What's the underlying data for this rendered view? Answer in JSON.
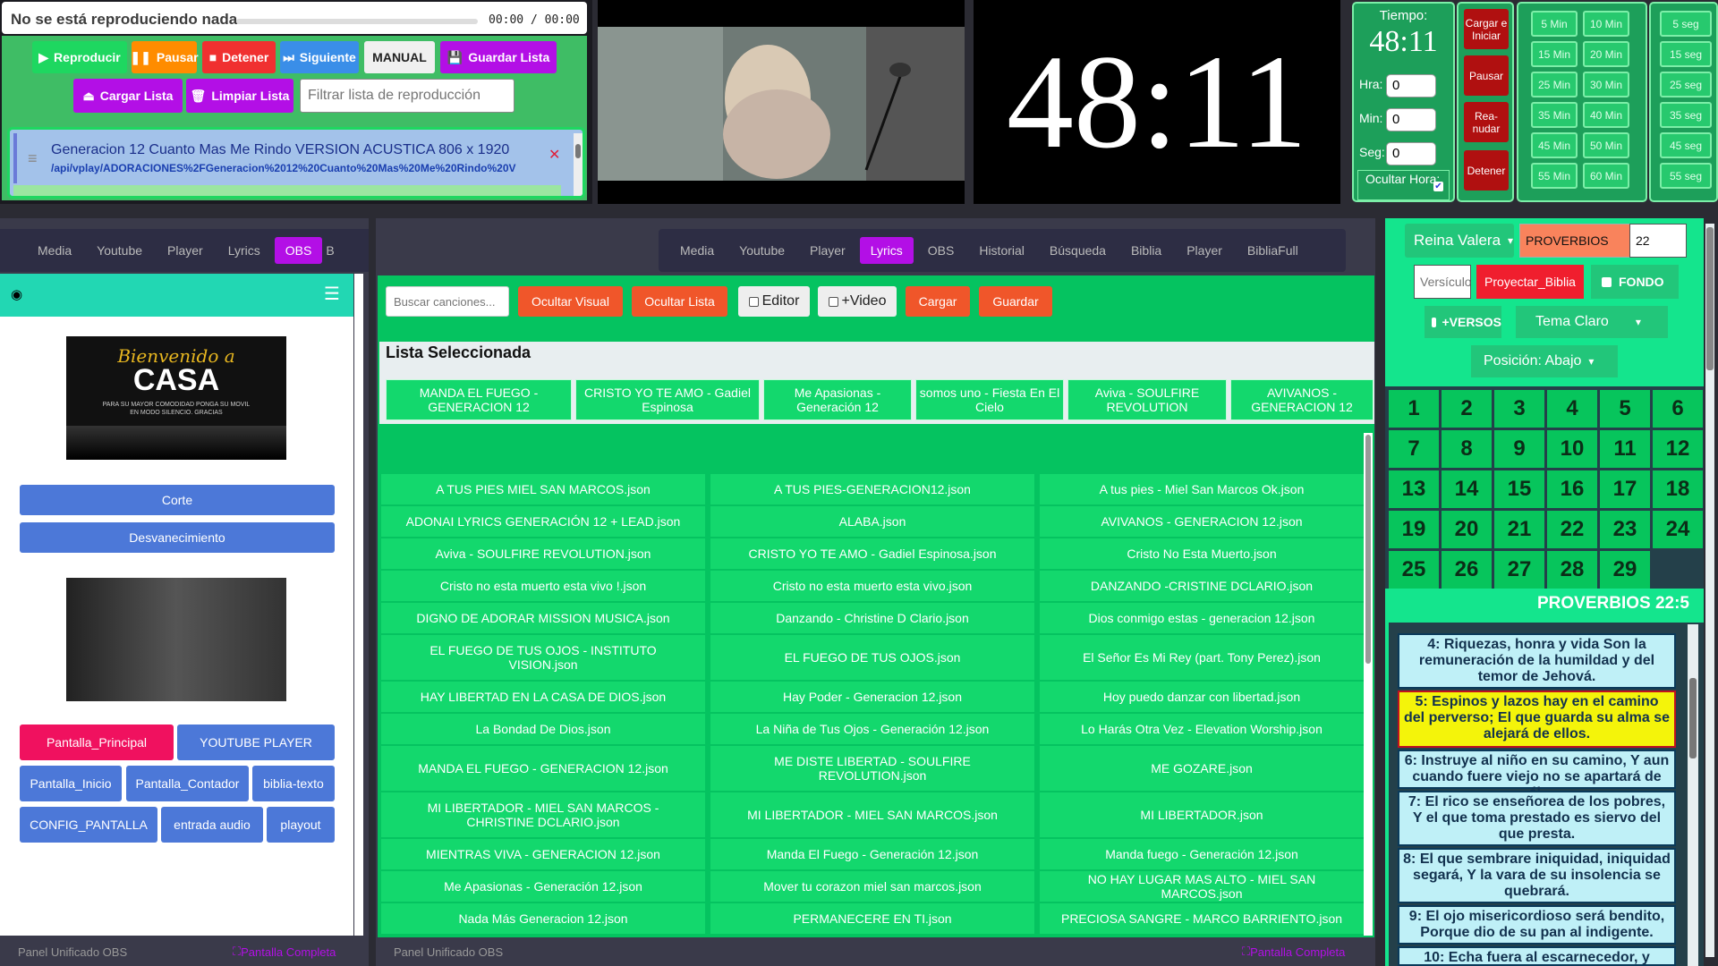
{
  "player": {
    "now_playing": "No se está reproduciendo nada",
    "time": "00:00 / 00:00",
    "play": "Reproducir",
    "pause": "Pausar",
    "stop": "Detener",
    "next": "Siguiente",
    "manual": "MANUAL",
    "save_list": "Guardar Lista",
    "load_list": "Cargar Lista",
    "clear_list": "Limpiar Lista",
    "filter_placeholder": "Filtrar lista de reproducción",
    "playlist_title": "Generacion 12 Cuanto Mas Me Rindo VERSION ACUSTICA 806 x 1920",
    "playlist_path": "/api/vplay/ADORACIONES%2FGeneracion%2012%20Cuanto%20Mas%20Me%20Rindo%20V"
  },
  "clock": "48:11",
  "timer": {
    "label": "Tiempo:",
    "value": "48:11",
    "hra": "Hra:",
    "min": "Min:",
    "seg": "Seg:",
    "hra_val": "0",
    "min_val": "0",
    "seg_val": "0",
    "hide_hour": "Ocultar Hora:",
    "load_start": "Cargar e Iniciar",
    "pause": "Pausar",
    "resume": "Rea-nudar",
    "stop": "Detener",
    "minutes": [
      "5 Min",
      "10 Min",
      "15 Min",
      "20 Min",
      "25 Min",
      "30 Min",
      "35 Min",
      "40 Min",
      "45 Min",
      "50 Min",
      "55 Min",
      "60 Min"
    ],
    "seconds": [
      "5 seg",
      "15 seg",
      "25 seg",
      "35 seg",
      "45 seg",
      "55 seg"
    ]
  },
  "obs": {
    "tabs": [
      "Media",
      "Youtube",
      "Player",
      "Lyrics",
      "OBS",
      "B"
    ],
    "corte": "Corte",
    "fade": "Desvanecimiento",
    "welcome1": "Bienvenido a",
    "welcome2": "CASA",
    "welcome3": "PARA SU MAYOR COMODIDAD PONGA SU MOVIL EN MODO SILENCIO. GRACIAS",
    "scenes": [
      "Pantalla_Principal",
      "YOUTUBE PLAYER",
      "Pantalla_Inicio",
      "Pantalla_Contador",
      "biblia-texto",
      "CONFIG_PANTALLA",
      "entrada audio",
      "playout"
    ],
    "footer": "Panel Unificado OBS",
    "fullscreen": "Pantalla Completa"
  },
  "lyrics": {
    "tabs": [
      "Media",
      "Youtube",
      "Player",
      "Lyrics",
      "OBS",
      "Historial",
      "Búsqueda",
      "Biblia",
      "Player",
      "BibliaFull"
    ],
    "search_placeholder": "Buscar canciones...",
    "hide_visual": "Ocultar Visual",
    "hide_list": "Ocultar Lista",
    "editor": "Editor",
    "video": "+Video",
    "load": "Cargar",
    "save": "Guardar",
    "selected_title": "Lista Seleccionada",
    "selected": [
      "MANDA EL FUEGO - GENERACION 12",
      "CRISTO YO TE AMO - Gadiel Espinosa",
      "Me Apasionas - Generación 12",
      "somos uno - Fiesta En El Cielo",
      "Aviva - SOULFIRE REVOLUTION",
      "AVIVANOS - GENERACION 12"
    ],
    "files": [
      "A TUS PIES MIEL SAN MARCOS.json",
      "A TUS PIES-GENERACION12.json",
      "A tus pies - Miel San Marcos Ok.json",
      "ADONAI LYRICS GENERACIÓN 12 + LEAD.json",
      "ALABA.json",
      "AVIVANOS - GENERACION 12.json",
      "Aviva - SOULFIRE REVOLUTION.json",
      "CRISTO YO TE AMO - Gadiel Espinosa.json",
      "Cristo No Esta Muerto.json",
      "Cristo no esta muerto esta vivo !.json",
      "Cristo no esta muerto esta vivo.json",
      "DANZANDO -CRISTINE DCLARIO.json",
      "DIGNO DE ADORAR MISSION MUSICA.json",
      "Danzando - Christine D Clario.json",
      "Dios conmigo estas - generacion 12.json",
      "EL FUEGO DE TUS OJOS - INSTITUTO VISION.json",
      "EL FUEGO DE TUS OJOS.json",
      "El Señor Es Mi Rey (part. Tony Perez).json",
      "HAY LIBERTAD EN LA CASA DE DIOS.json",
      "Hay Poder - Generacion 12.json",
      "Hoy puedo danzar con libertad.json",
      "La Bondad De Dios.json",
      "La Niña de Tus Ojos - Generación 12.json",
      "Lo Harás Otra Vez - Elevation Worship.json",
      "MANDA EL FUEGO - GENERACION 12.json",
      "ME DISTE LIBERTAD - SOULFIRE REVOLUTION.json",
      "ME GOZARE.json",
      "MI LIBERTADOR - MIEL SAN MARCOS - CHRISTINE DCLARIO.json",
      "MI LIBERTADOR - MIEL SAN MARCOS.json",
      "MI LIBERTADOR.json",
      "MIENTRAS VIVA - GENERACION 12.json",
      "Manda El Fuego - Generación 12.json",
      "Manda fuego - Generación 12.json",
      "Me Apasionas - Generación 12.json",
      "Mover tu corazon miel san marcos.json",
      "NO HAY LUGAR MAS ALTO - MIEL SAN MARCOS.json",
      "Nada Más Generacion 12.json",
      "PERMANECERE EN TI.json",
      "PRECIOSA SANGRE - MARCO BARRIENTO.json"
    ],
    "footer": "Panel Unificado OBS",
    "fullscreen": "Pantalla Completa"
  },
  "bible": {
    "version": "Reina Valera",
    "book": "PROVERBIOS",
    "chapter": "22",
    "verse_placeholder": "Versículo",
    "project": "Proyectar_Biblia",
    "fondo": "FONDO",
    "versos": "+VERSOS",
    "theme": "Tema Claro",
    "position": "Posición: Abajo",
    "reference": "PROVERBIOS 22:5",
    "verses": [
      "4: Riquezas, honra y vida Son la remuneración de la humildad y del temor de Jehová.",
      "5: Espinos y lazos hay en el camino del perverso; El que guarda su alma se alejará de ellos.",
      "6: Instruye al niño en su camino, Y aun cuando fuere viejo no se apartará de él.",
      "7: El rico se enseñorea de los pobres, Y el que toma prestado es siervo del que presta.",
      "8: El que sembrare iniquidad, iniquidad segará, Y la vara de su insolencia se quebrará.",
      "9: El ojo misericordioso será bendito, Porque dio de su pan al indigente.",
      "10: Echa fuera al escarnecedor, y"
    ]
  },
  "colors": {
    "accent": "#b30fe6",
    "green": "#05c360",
    "orange": "#f0562a",
    "red": "#b01010",
    "blue": "#4c78d8"
  }
}
